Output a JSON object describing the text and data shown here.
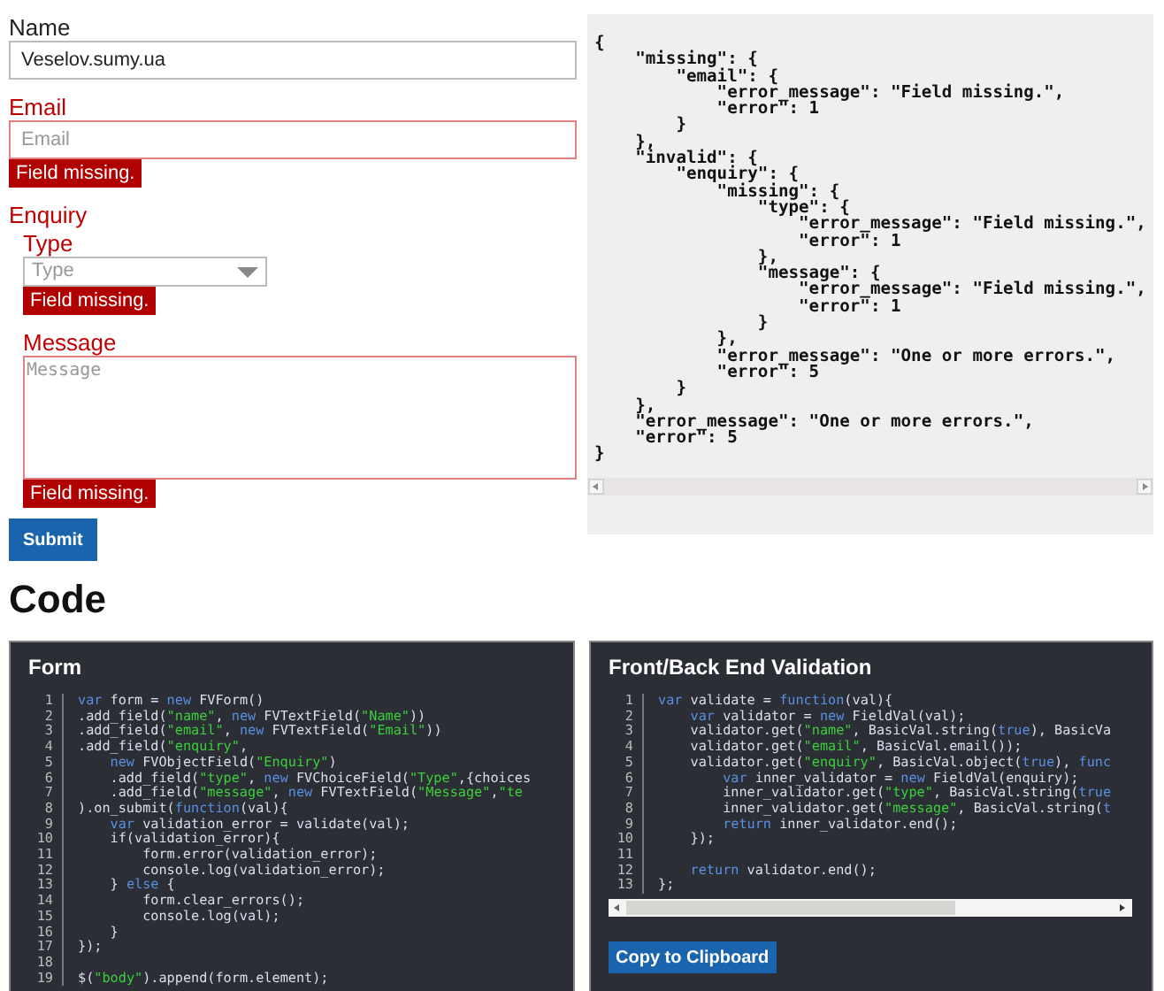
{
  "form": {
    "fields": [
      {
        "kind": "text",
        "label": "Name",
        "value": "Veselov.sumy.ua",
        "error": false
      },
      {
        "kind": "text",
        "label": "Email",
        "placeholder": "Email",
        "error": true,
        "error_message": "Field missing."
      },
      {
        "kind": "group",
        "label": "Enquiry",
        "error": true,
        "children": [
          {
            "kind": "select",
            "label": "Type",
            "placeholder": "Type",
            "error": true,
            "error_message": "Field missing."
          },
          {
            "kind": "textarea",
            "label": "Message",
            "placeholder": "Message",
            "error": true,
            "error_message": "Field missing."
          }
        ]
      }
    ],
    "submit": "Submit"
  },
  "output": {
    "text": "{\n    \"missing\": {\n        \"email\": {\n            \"error_message\": \"Field missing.\",\n            \"error\": 1\n        }\n    },\n    \"invalid\": {\n        \"enquiry\": {\n            \"missing\": {\n                \"type\": {\n                    \"error_message\": \"Field missing.\",\n                    \"error\": 1\n                },\n                \"message\": {\n                    \"error_message\": \"Field missing.\",\n                    \"error\": 1\n                }\n            },\n            \"error_message\": \"One or more errors.\",\n            \"error\": 5\n        }\n    },\n    \"error_message\": \"One or more errors.\",\n    \"error\": 5\n}"
  },
  "code_heading": "Code",
  "code_panels": [
    {
      "title": "Form",
      "lines": [
        {
          "number": "1",
          "tokens": [
            {
              "kind": "keyword",
              "text": "var"
            },
            {
              "kind": "plain",
              "text": " form = "
            },
            {
              "kind": "keyword",
              "text": "new"
            },
            {
              "kind": "plain",
              "text": " FVForm()"
            }
          ]
        },
        {
          "number": "2",
          "tokens": [
            {
              "kind": "plain",
              "text": ".add_field("
            },
            {
              "kind": "string",
              "text": "\"name\""
            },
            {
              "kind": "plain",
              "text": ", "
            },
            {
              "kind": "keyword",
              "text": "new"
            },
            {
              "kind": "plain",
              "text": " FVTextField("
            },
            {
              "kind": "string",
              "text": "\"Name\""
            },
            {
              "kind": "plain",
              "text": "))"
            }
          ]
        },
        {
          "number": "3",
          "tokens": [
            {
              "kind": "plain",
              "text": ".add_field("
            },
            {
              "kind": "string",
              "text": "\"email\""
            },
            {
              "kind": "plain",
              "text": ", "
            },
            {
              "kind": "keyword",
              "text": "new"
            },
            {
              "kind": "plain",
              "text": " FVTextField("
            },
            {
              "kind": "string",
              "text": "\"Email\""
            },
            {
              "kind": "plain",
              "text": "))"
            }
          ]
        },
        {
          "number": "4",
          "tokens": [
            {
              "kind": "plain",
              "text": ".add_field("
            },
            {
              "kind": "string",
              "text": "\"enquiry\""
            },
            {
              "kind": "plain",
              "text": ","
            }
          ]
        },
        {
          "number": "5",
          "tokens": [
            {
              "kind": "keyword",
              "text": "    new"
            },
            {
              "kind": "plain",
              "text": " FVObjectField("
            },
            {
              "kind": "string",
              "text": "\"Enquiry\""
            },
            {
              "kind": "plain",
              "text": ")"
            }
          ]
        },
        {
          "number": "6",
          "tokens": [
            {
              "kind": "plain",
              "text": "    .add_field("
            },
            {
              "kind": "string",
              "text": "\"type\""
            },
            {
              "kind": "plain",
              "text": ", "
            },
            {
              "kind": "keyword",
              "text": "new"
            },
            {
              "kind": "plain",
              "text": " FVChoiceField("
            },
            {
              "kind": "string",
              "text": "\"Type\""
            },
            {
              "kind": "plain",
              "text": ",{choices"
            }
          ]
        },
        {
          "number": "7",
          "tokens": [
            {
              "kind": "plain",
              "text": "    .add_field("
            },
            {
              "kind": "string",
              "text": "\"message\""
            },
            {
              "kind": "plain",
              "text": ", "
            },
            {
              "kind": "keyword",
              "text": "new"
            },
            {
              "kind": "plain",
              "text": " FVTextField("
            },
            {
              "kind": "string",
              "text": "\"Message\""
            },
            {
              "kind": "plain",
              "text": ","
            },
            {
              "kind": "string",
              "text": "\"te"
            }
          ]
        },
        {
          "number": "8",
          "tokens": [
            {
              "kind": "plain",
              "text": ").on_submit("
            },
            {
              "kind": "keyword",
              "text": "function"
            },
            {
              "kind": "plain",
              "text": "(val){"
            }
          ]
        },
        {
          "number": "9",
          "tokens": [
            {
              "kind": "keyword",
              "text": "    var"
            },
            {
              "kind": "plain",
              "text": " validation_error = validate(val);"
            }
          ]
        },
        {
          "number": "10",
          "tokens": [
            {
              "kind": "plain",
              "text": "    if(validation_error){"
            }
          ]
        },
        {
          "number": "11",
          "tokens": [
            {
              "kind": "plain",
              "text": "        form.error(validation_error);"
            }
          ]
        },
        {
          "number": "12",
          "tokens": [
            {
              "kind": "plain",
              "text": "        console.log(validation_error);"
            }
          ]
        },
        {
          "number": "13",
          "tokens": [
            {
              "kind": "plain",
              "text": "    } "
            },
            {
              "kind": "keyword",
              "text": "else"
            },
            {
              "kind": "plain",
              "text": " {"
            }
          ]
        },
        {
          "number": "14",
          "tokens": [
            {
              "kind": "plain",
              "text": "        form.clear_errors();"
            }
          ]
        },
        {
          "number": "15",
          "tokens": [
            {
              "kind": "plain",
              "text": "        console.log(val);"
            }
          ]
        },
        {
          "number": "16",
          "tokens": [
            {
              "kind": "plain",
              "text": "    }"
            }
          ]
        },
        {
          "number": "17",
          "tokens": [
            {
              "kind": "plain",
              "text": "});"
            }
          ]
        },
        {
          "number": "18"
        },
        {
          "number": "19",
          "tokens": [
            {
              "kind": "plain",
              "text": "$("
            },
            {
              "kind": "string",
              "text": "\"body\""
            },
            {
              "kind": "plain",
              "text": ").append(form.element);"
            }
          ]
        }
      ]
    },
    {
      "title": "Front/Back End Validation",
      "button": "Copy to Clipboard",
      "lines": [
        {
          "number": "1",
          "tokens": [
            {
              "kind": "keyword",
              "text": "var"
            },
            {
              "kind": "plain",
              "text": " validate = "
            },
            {
              "kind": "keyword",
              "text": "function"
            },
            {
              "kind": "plain",
              "text": "(val){"
            }
          ]
        },
        {
          "number": "2",
          "tokens": [
            {
              "kind": "keyword",
              "text": "    var"
            },
            {
              "kind": "plain",
              "text": " validator = "
            },
            {
              "kind": "keyword",
              "text": "new"
            },
            {
              "kind": "plain",
              "text": " FieldVal(val);"
            }
          ]
        },
        {
          "number": "3",
          "tokens": [
            {
              "kind": "plain",
              "text": "    validator.get("
            },
            {
              "kind": "string",
              "text": "\"name\""
            },
            {
              "kind": "plain",
              "text": ", BasicVal.string("
            },
            {
              "kind": "keyword",
              "text": "true"
            },
            {
              "kind": "plain",
              "text": "), BasicVa"
            }
          ]
        },
        {
          "number": "4",
          "tokens": [
            {
              "kind": "plain",
              "text": "    validator.get("
            },
            {
              "kind": "string",
              "text": "\"email\""
            },
            {
              "kind": "plain",
              "text": ", BasicVal.email());"
            }
          ]
        },
        {
          "number": "5",
          "tokens": [
            {
              "kind": "plain",
              "text": "    validator.get("
            },
            {
              "kind": "string",
              "text": "\"enquiry\""
            },
            {
              "kind": "plain",
              "text": ", BasicVal.object("
            },
            {
              "kind": "keyword",
              "text": "true"
            },
            {
              "kind": "plain",
              "text": "), "
            },
            {
              "kind": "keyword",
              "text": "func"
            }
          ]
        },
        {
          "number": "6",
          "tokens": [
            {
              "kind": "keyword",
              "text": "        var"
            },
            {
              "kind": "plain",
              "text": " inner_validator = "
            },
            {
              "kind": "keyword",
              "text": "new"
            },
            {
              "kind": "plain",
              "text": " FieldVal(enquiry);"
            }
          ]
        },
        {
          "number": "7",
          "tokens": [
            {
              "kind": "plain",
              "text": "        inner_validator.get("
            },
            {
              "kind": "string",
              "text": "\"type\""
            },
            {
              "kind": "plain",
              "text": ", BasicVal.string("
            },
            {
              "kind": "keyword",
              "text": "true"
            }
          ]
        },
        {
          "number": "8",
          "tokens": [
            {
              "kind": "plain",
              "text": "        inner_validator.get("
            },
            {
              "kind": "string",
              "text": "\"message\""
            },
            {
              "kind": "plain",
              "text": ", BasicVal.string("
            },
            {
              "kind": "keyword",
              "text": "t"
            }
          ]
        },
        {
          "number": "9",
          "tokens": [
            {
              "kind": "keyword",
              "text": "        return"
            },
            {
              "kind": "plain",
              "text": " inner_validator.end();"
            }
          ]
        },
        {
          "number": "10",
          "tokens": [
            {
              "kind": "plain",
              "text": "    });"
            }
          ]
        },
        {
          "number": "11"
        },
        {
          "number": "12",
          "tokens": [
            {
              "kind": "keyword",
              "text": "    return"
            },
            {
              "kind": "plain",
              "text": " validator.end();"
            }
          ]
        },
        {
          "number": "13",
          "tokens": [
            {
              "kind": "plain",
              "text": "};"
            }
          ]
        }
      ]
    }
  ]
}
